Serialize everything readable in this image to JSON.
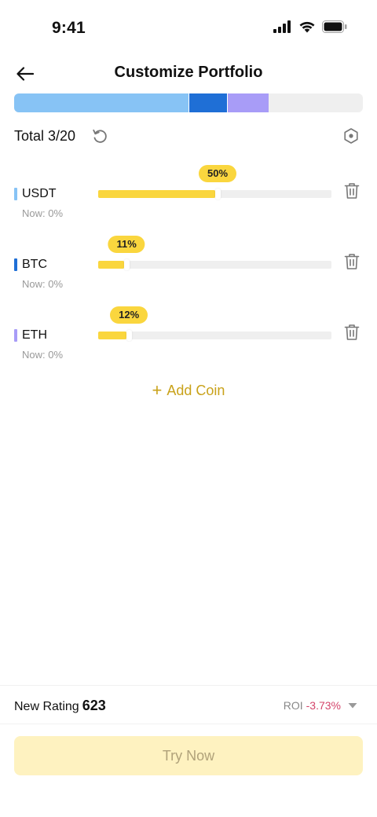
{
  "status": {
    "time": "9:41"
  },
  "header": {
    "title": "Customize Portfolio"
  },
  "allocation": {
    "segments": [
      {
        "coin": "USDT",
        "percent": 50,
        "color": "#87c3f5"
      },
      {
        "coin": "BTC",
        "percent": 11,
        "color": "#1f6fd6"
      },
      {
        "coin": "ETH",
        "percent": 12,
        "color": "#a89cf7"
      }
    ],
    "remainder_color": "#efefef"
  },
  "summary": {
    "total_label": "Total 3/20"
  },
  "coins": [
    {
      "name": "USDT",
      "percent": 50,
      "percent_label": "50%",
      "now": "Now: 0%",
      "color": "#87c3f5"
    },
    {
      "name": "BTC",
      "percent": 11,
      "percent_label": "11%",
      "now": "Now: 0%",
      "color": "#1f6fd6"
    },
    {
      "name": "ETH",
      "percent": 12,
      "percent_label": "12%",
      "now": "Now: 0%",
      "color": "#a89cf7"
    }
  ],
  "add_coin": {
    "plus": "+",
    "label": "Add Coin"
  },
  "footer": {
    "rating_label": "New Rating",
    "rating_value": "623",
    "roi_label": "ROI",
    "roi_value": "-3.73%",
    "try_label": "Try Now"
  },
  "colors": {
    "accent": "#fad63e",
    "add_coin": "#c9a21a",
    "roi_negative": "#d4446a",
    "button_disabled_bg": "#fef2c0"
  },
  "icons": [
    "signal-icon",
    "wifi-icon",
    "battery-icon",
    "back-arrow-icon",
    "reset-icon",
    "settings-hex-icon",
    "trash-icon",
    "caret-down-icon"
  ]
}
